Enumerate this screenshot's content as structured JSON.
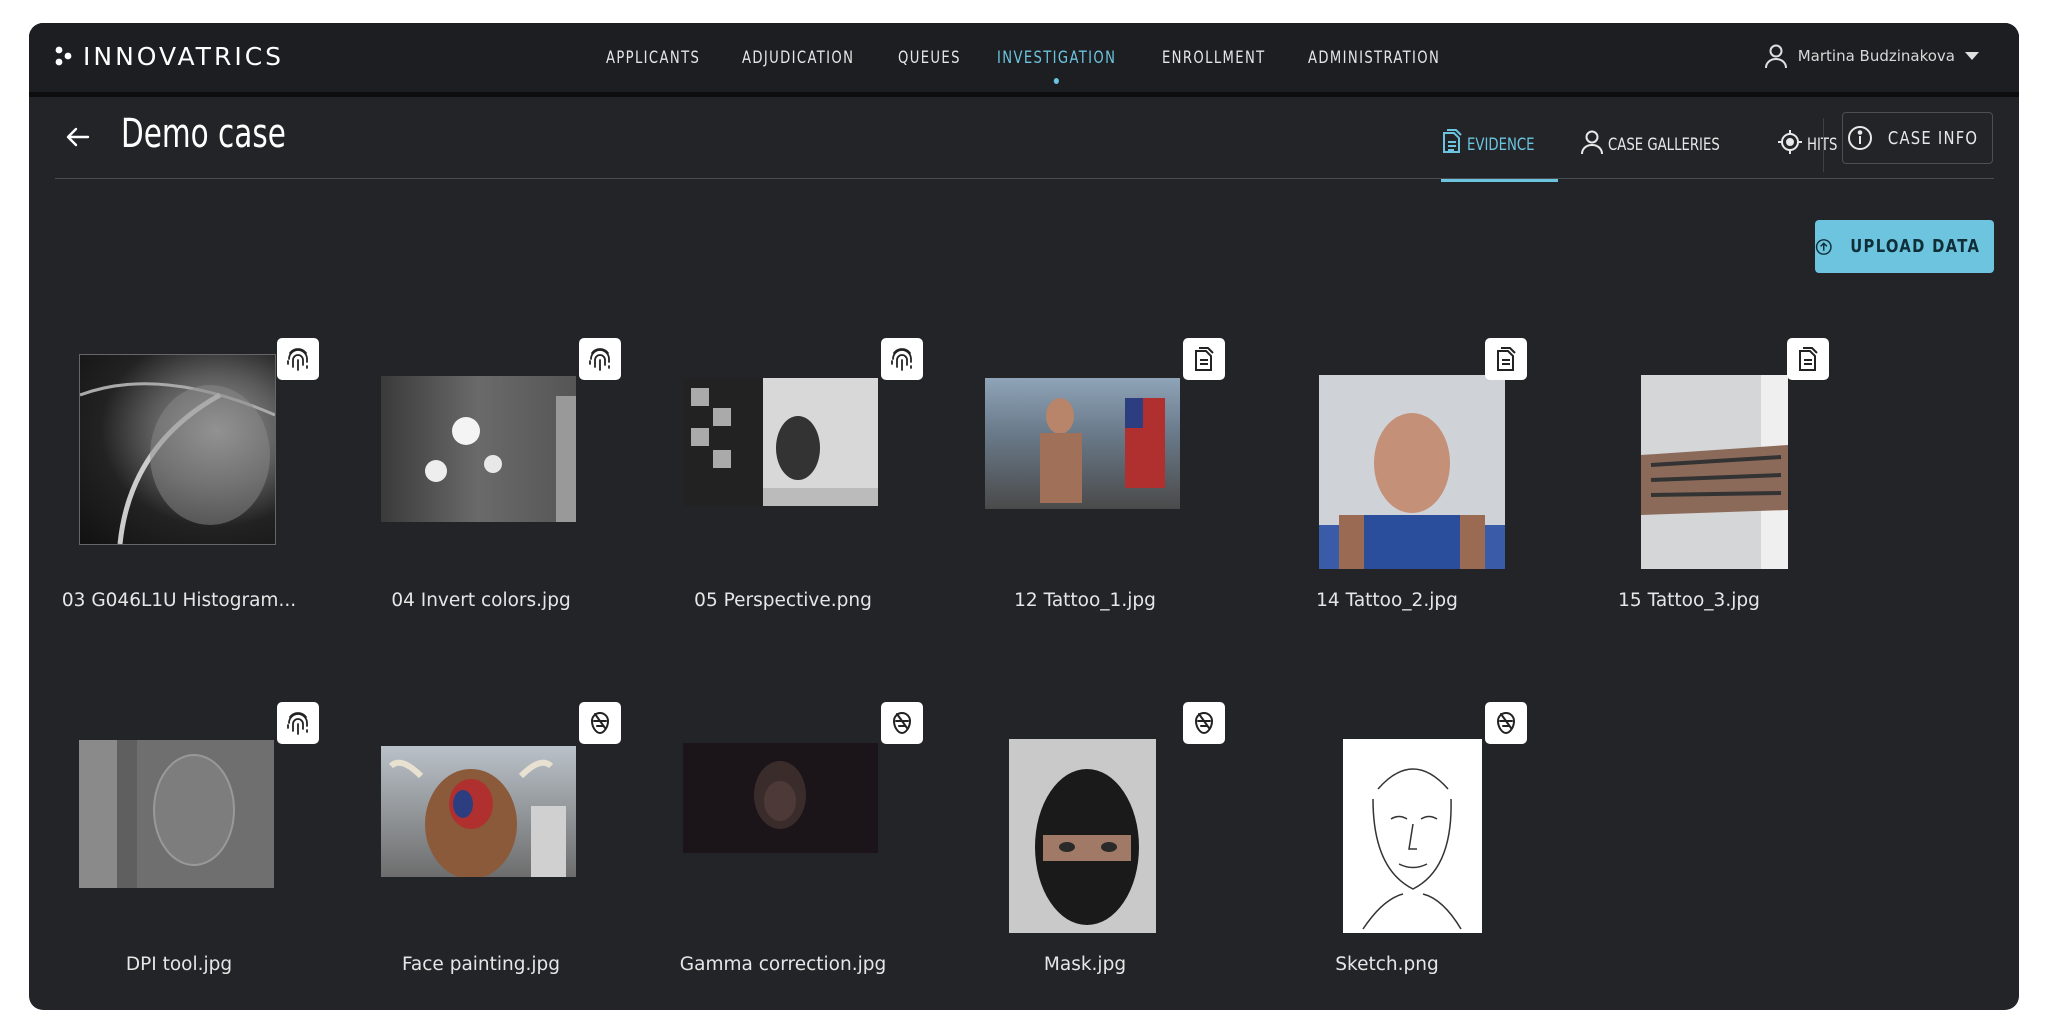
{
  "app": {
    "logo_text": "INNOVATRICS"
  },
  "nav": {
    "items": [
      {
        "label": "APPLICANTS"
      },
      {
        "label": "ADJUDICATION"
      },
      {
        "label": "QUEUES"
      },
      {
        "label": "INVESTIGATION",
        "active": true
      },
      {
        "label": "ENROLLMENT"
      },
      {
        "label": "ADMINISTRATION"
      }
    ]
  },
  "user": {
    "name": "Martina Budzinakova"
  },
  "header": {
    "title": "Demo case",
    "tabs": [
      {
        "label": "EVIDENCE",
        "icon": "document-icon",
        "active": true
      },
      {
        "label": "CASE GALLERIES",
        "icon": "person-icon"
      },
      {
        "label": "HITS",
        "icon": "target-icon"
      }
    ],
    "case_info_label": "CASE INFO"
  },
  "upload_label": "UPLOAD DATA",
  "evidence": [
    {
      "name": "03 G046L1U Histogram...",
      "type": "fingerprint-icon"
    },
    {
      "name": "04 Invert colors.jpg",
      "type": "fingerprint-icon"
    },
    {
      "name": "05 Perspective.png",
      "type": "fingerprint-icon"
    },
    {
      "name": "12 Tattoo_1.jpg",
      "type": "document-icon"
    },
    {
      "name": "14 Tattoo_2.jpg",
      "type": "document-icon"
    },
    {
      "name": "15 Tattoo_3.jpg",
      "type": "document-icon"
    },
    {
      "name": "DPI tool.jpg",
      "type": "fingerprint-icon"
    },
    {
      "name": "Face painting.jpg",
      "type": "face-icon"
    },
    {
      "name": "Gamma correction.jpg",
      "type": "face-icon"
    },
    {
      "name": "Mask.jpg",
      "type": "face-icon"
    },
    {
      "name": "Sketch.png",
      "type": "face-icon"
    }
  ],
  "colors": {
    "accent": "#6cc4df",
    "background": "#222427",
    "topbar": "#1d1e21"
  }
}
